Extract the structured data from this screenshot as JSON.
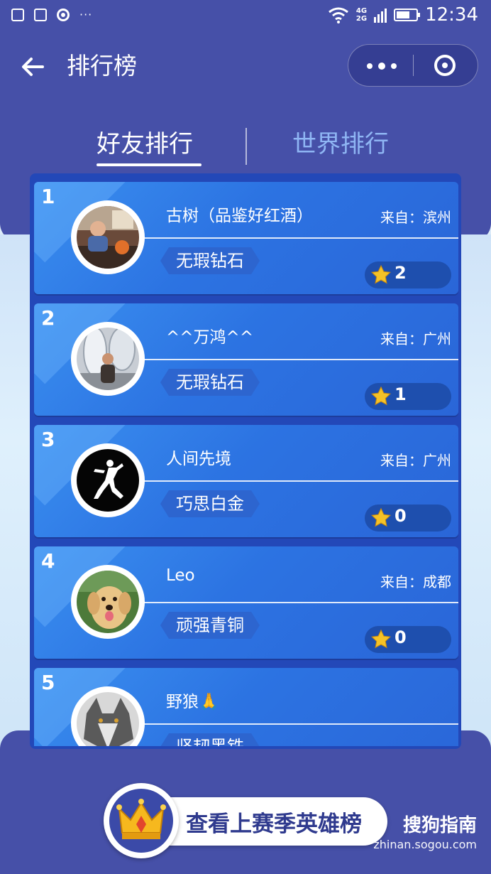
{
  "status_bar": {
    "time": "12:34",
    "network_top": "4G",
    "network_bottom": "2G",
    "more_dots": "···"
  },
  "nav": {
    "title": "排行榜"
  },
  "tabs": [
    {
      "label": "好友排行",
      "active": true
    },
    {
      "label": "世界排行",
      "active": false
    }
  ],
  "players": [
    {
      "rank": "1",
      "name": "古树（品鉴好红酒）",
      "location": "来自：滨州",
      "level": "无瑕钻石",
      "stars": "2",
      "avatar": "photo-man-at-table"
    },
    {
      "rank": "2",
      "name": "^^万鸿^^",
      "location": "来自：广州",
      "level": "无瑕钻石",
      "stars": "1",
      "avatar": "photo-man-outdoors"
    },
    {
      "rank": "3",
      "name": "人间先境",
      "location": "来自：广州",
      "level": "巧思白金",
      "stars": "0",
      "avatar": "jumpman-logo"
    },
    {
      "rank": "4",
      "name": "Leo",
      "location": "来自：成都",
      "level": "顽强青铜",
      "stars": "0",
      "avatar": "photo-golden-retriever"
    },
    {
      "rank": "5",
      "name": "野狼🙏",
      "location": "",
      "level": "坚韧黑铁",
      "stars": "",
      "avatar": "photo-wolf"
    }
  ],
  "hero_button": {
    "label": "查看上赛季英雄榜",
    "icon": "crown-icon"
  },
  "watermark": {
    "logo": "搜狗指南",
    "url": "zhinan.sogou.com"
  },
  "colors": {
    "header_bg": "#4650a8",
    "card_blue": "#2c73e2",
    "tab_inactive": "#8fb6f4",
    "star": "#f5c227"
  }
}
